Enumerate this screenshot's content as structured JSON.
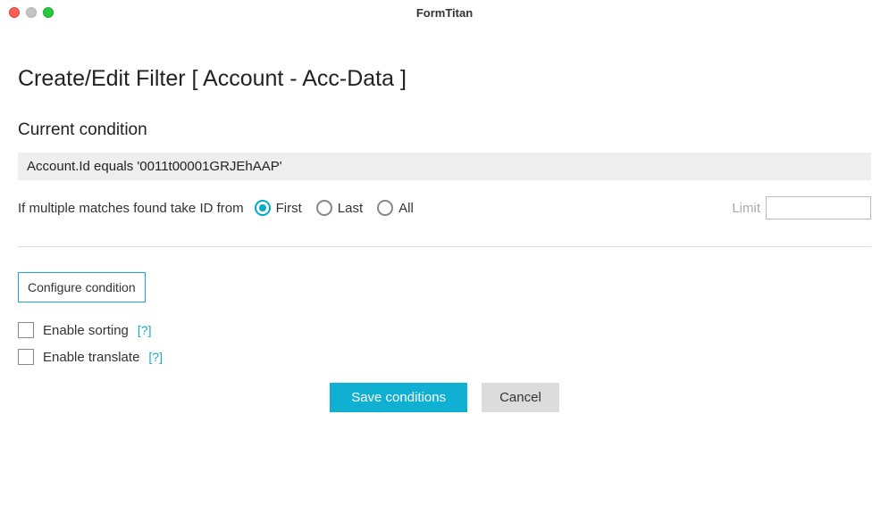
{
  "window": {
    "title": "FormTitan"
  },
  "page": {
    "title": "Create/Edit Filter [ Account - Acc-Data ]"
  },
  "condition": {
    "section_label": "Current condition",
    "text": "Account.Id equals '0011t00001GRJEhAAP'"
  },
  "match": {
    "label": "If multiple matches found take ID from",
    "options": {
      "first": "First",
      "last": "Last",
      "all": "All"
    },
    "limit_label": "Limit",
    "limit_value": ""
  },
  "buttons": {
    "configure": "Configure condition",
    "save": "Save conditions",
    "cancel": "Cancel"
  },
  "checkboxes": {
    "sorting_label": "Enable sorting",
    "translate_label": "Enable translate",
    "help": "[?]"
  }
}
